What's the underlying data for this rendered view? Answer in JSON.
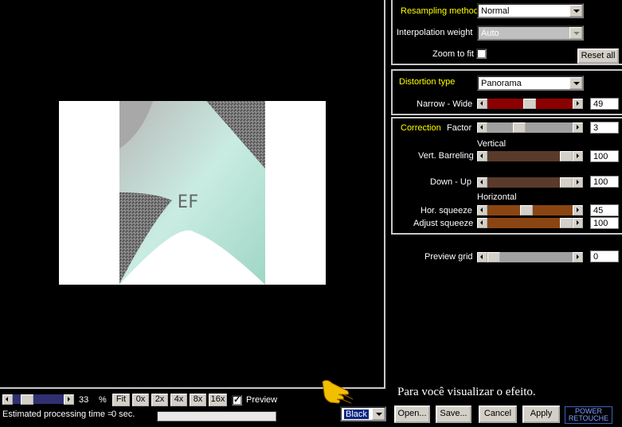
{
  "resampling": {
    "label": "Resampling method",
    "value": "Normal"
  },
  "interpolation": {
    "label": "Interpolation weight",
    "value": "Auto"
  },
  "zoom_to_fit": {
    "label": "Zoom to fit",
    "checked": false
  },
  "reset_all": "Reset all",
  "distortion": {
    "type_label": "Distortion type",
    "type_value": "Panorama",
    "narrow_wide": {
      "label": "Narrow - Wide",
      "value": "49",
      "fraction": 0.49,
      "color": "#8b0000"
    }
  },
  "correction": {
    "title": "Correction",
    "factor": {
      "label": "Factor",
      "value": "3",
      "fraction": 0.35,
      "color": "#a0a0a0"
    },
    "vertical_heading": "Vertical",
    "vert_barreling": {
      "label": "Vert. Barreling",
      "value": "100",
      "fraction": 1.0,
      "color": "#5a3a2a"
    },
    "down_up": {
      "label": "Down - Up",
      "value": "100",
      "fraction": 1.0,
      "color": "#5a3a2a"
    },
    "horizontal_heading": "Horizontal",
    "hor_squeeze": {
      "label": "Hor. squeeze",
      "value": "45",
      "fraction": 0.45,
      "color": "#8b4513"
    },
    "adjust_squeeze": {
      "label": "Adjust squeeze",
      "value": "100",
      "fraction": 1.0,
      "color": "#8b4513"
    }
  },
  "preview_grid": {
    "label": "Preview grid",
    "value": "0",
    "fraction": 0.0,
    "color": "#a0a0a0"
  },
  "zoom": {
    "value": "33",
    "unit": "%",
    "fraction": 0.2
  },
  "zoom_buttons": [
    "Fit",
    "0x",
    "2x",
    "4x",
    "8x",
    "16x"
  ],
  "preview": {
    "label": "Preview",
    "checked": true
  },
  "processing": {
    "label": "Estimated processing time =",
    "value": "0 sec."
  },
  "background": {
    "value": "Black"
  },
  "buttons": {
    "open": "Open...",
    "save": "Save...",
    "cancel": "Cancel",
    "apply": "Apply"
  },
  "caption": "Para você visualizar o efeito.",
  "logo": {
    "line1": "POWER",
    "line2": "RETOUCHE"
  },
  "preview_text": "EF",
  "colors": {
    "panel_border": "#c8c8c8",
    "highlight_label": "#ffff00",
    "mint": "#c9ece2"
  }
}
